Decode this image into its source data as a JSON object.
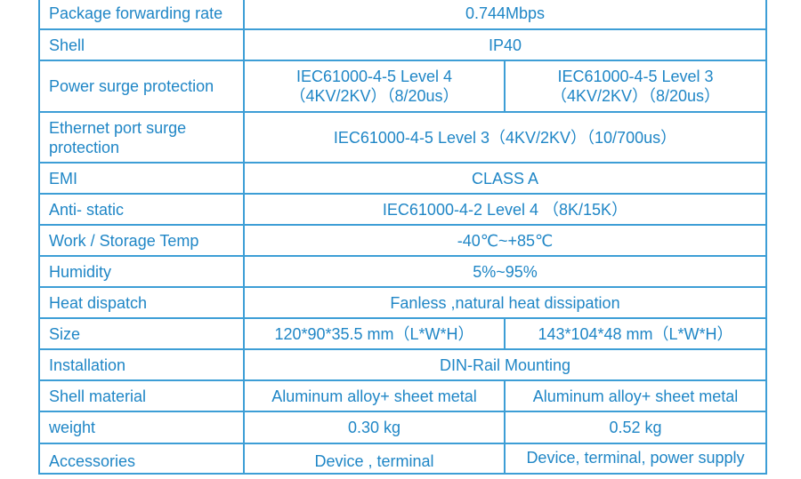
{
  "spec_table": {
    "border_color": "#3d9ed6",
    "text_color": "#1f86c6",
    "rows": [
      {
        "label": "Package forwarding rate",
        "values": [
          "0.744Mbps"
        ]
      },
      {
        "label": "Shell",
        "values": [
          "IP40"
        ]
      },
      {
        "label": "Power surge protection",
        "values": [
          "IEC61000-4-5 Level 4\n（4KV/2KV）（8/20us）",
          "IEC61000-4-5 Level 3\n（4KV/2KV）（8/20us）"
        ]
      },
      {
        "label": "Ethernet port surge protection",
        "values": [
          "IEC61000-4-5  Level 3（4KV/2KV）（10/700us）"
        ]
      },
      {
        "label": "EMI",
        "values": [
          "CLASS A"
        ]
      },
      {
        "label": "Anti- static",
        "values": [
          "IEC61000-4-2  Level 4 （8K/15K）"
        ]
      },
      {
        "label": "Work / Storage Temp",
        "values": [
          "-40℃~+85℃"
        ]
      },
      {
        "label": "Humidity",
        "values": [
          "5%~95%"
        ]
      },
      {
        "label": "Heat dispatch",
        "values": [
          "Fanless ,natural heat dissipation"
        ]
      },
      {
        "label": "Size",
        "values": [
          "120*90*35.5 mm（L*W*H）",
          "143*104*48 mm（L*W*H）"
        ]
      },
      {
        "label": "Installation",
        "values": [
          "DIN-Rail Mounting"
        ]
      },
      {
        "label": "Shell material",
        "values": [
          "Aluminum alloy+ sheet metal",
          "Aluminum alloy+ sheet metal"
        ]
      },
      {
        "label": "weight",
        "values": [
          "0.30 kg",
          "0.52 kg"
        ]
      },
      {
        "label": "Accessories",
        "values": [
          "Device , terminal",
          "Device, terminal, power supply"
        ]
      }
    ]
  }
}
